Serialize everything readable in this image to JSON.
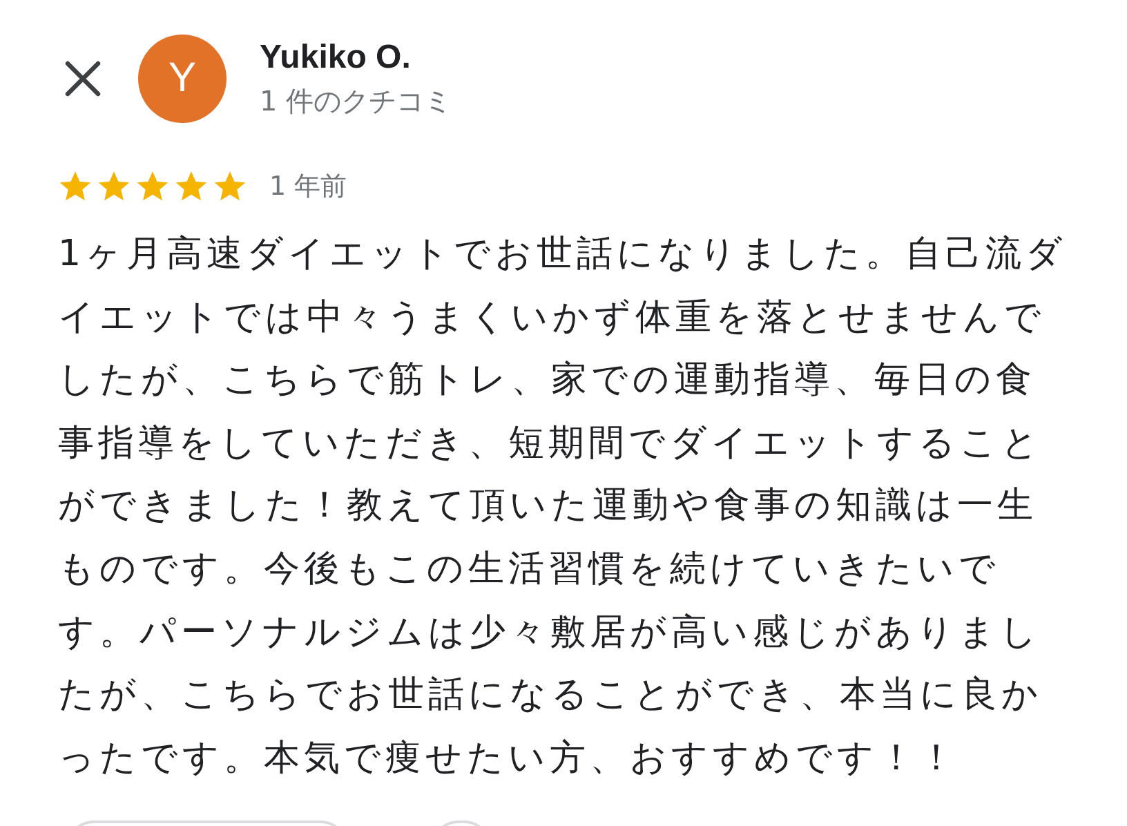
{
  "reviewer": {
    "avatar_letter": "Y",
    "name": "Yukiko O.",
    "review_count": "1 件のクチコミ"
  },
  "review": {
    "stars": 5,
    "time": "1 年前",
    "text": "1ヶ月高速ダイエットでお世話になりました。自己流ダイエットでは中々うまくいかず体重を落とせませんでしたが、こちらで筋トレ、家での運動指導、毎日の食事指導をしていただき、短期間でダイエットすることができました！教えて頂いた運動や食事の知識は一生ものです。今後もこの生活習慣を続けていきたいです。パーソナルジムは少々敷居が高い感じがありましたが、こちらでお世話になることができ、本当に良かったです。本気で痩せたい方、おすすめです！！"
  }
}
